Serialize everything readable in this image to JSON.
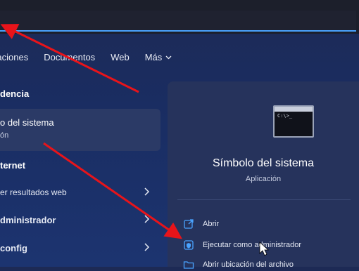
{
  "filters": [
    {
      "label": "icaciones"
    },
    {
      "label": "Documentos"
    },
    {
      "label": "Web"
    },
    {
      "label": "Más"
    }
  ],
  "sections": {
    "best_match_title": "dencia",
    "best_match_item": {
      "title": "o del sistema",
      "subtitle": "ón"
    },
    "internet_title": "ternet",
    "internet_row": "er resultados web",
    "admin_row": "dministrador",
    "config_row": "config"
  },
  "preview": {
    "app_name": "Símbolo del sistema",
    "app_type": "Aplicación",
    "icon_prompt": "C:\\>_",
    "actions": [
      {
        "label": "Abrir"
      },
      {
        "label": "Ejecutar como administrador"
      },
      {
        "label": "Abrir ubicación del archivo"
      }
    ]
  },
  "colors": {
    "accent": "#4aa3ff",
    "annotation_arrow": "#e8141a",
    "background": "#1d2a55",
    "panel": "#26335c"
  }
}
